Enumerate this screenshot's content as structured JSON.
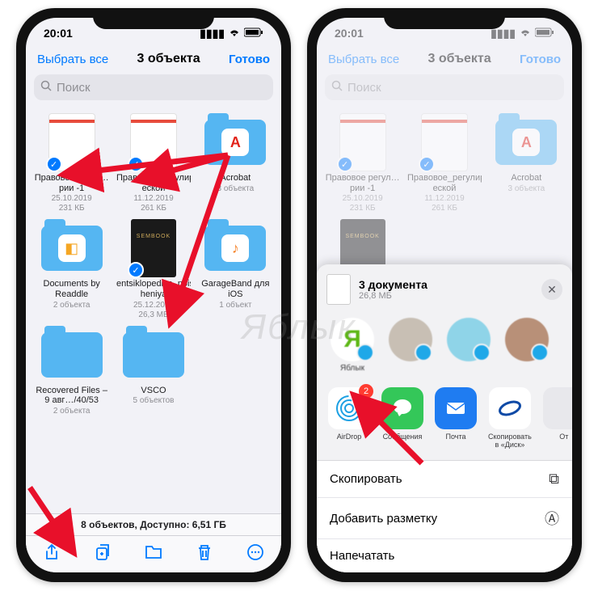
{
  "status": {
    "time": "20:01"
  },
  "left": {
    "nav": {
      "select_all": "Выбрать все",
      "title": "3 объекта",
      "done": "Готово"
    },
    "search": {
      "placeholder": "Поиск"
    },
    "items": [
      {
        "name": "Правовое регул…рии -1",
        "date": "25.10.2019",
        "size": "231 КБ",
        "type": "doc",
        "checked": true
      },
      {
        "name": "Правовое_регулиро…еской",
        "date": "11.12.2019",
        "size": "261 КБ",
        "type": "doc",
        "checked": true
      },
      {
        "name": "Acrobat",
        "sub": "3 объекта",
        "type": "folder",
        "icon_bg": "#fff",
        "icon_color": "#e2231a",
        "icon": "A"
      },
      {
        "name": "Documents by Readdle",
        "sub": "2 объекта",
        "type": "folder",
        "icon_bg": "#fff",
        "icon_color": "#f5a623",
        "icon": "◧"
      },
      {
        "name": "entsiklopediya_poisko…heniya",
        "date": "25.12.2019",
        "size": "26,3 МБ",
        "type": "sembook",
        "checked": true
      },
      {
        "name": "GarageBand для iOS",
        "sub": "1 объект",
        "type": "folder",
        "icon_bg": "#fff",
        "icon_color": "#f5842b",
        "icon": "♪"
      },
      {
        "name": "Recovered Files – 9 авг…/40/53",
        "sub": "2 объекта",
        "type": "folder"
      },
      {
        "name": "VSCO",
        "sub": "5 объектов",
        "type": "folder"
      }
    ],
    "footer": "8 объектов, Доступно: 6,51 ГБ"
  },
  "right": {
    "nav": {
      "select_all": "Выбрать все",
      "title": "3 объекта",
      "done": "Готово"
    },
    "sheet": {
      "title": "3 документа",
      "size": "26,8 МБ",
      "contacts": [
        {
          "name": "Яблык",
          "bg": "#fff",
          "fg": "#5db715",
          "letter": "Я"
        }
      ],
      "apps": [
        {
          "name": "AirDrop",
          "bg": "#ffffff",
          "fg": "#1ca0e3",
          "badge": "2"
        },
        {
          "name": "Сообщения",
          "bg": "#34c759"
        },
        {
          "name": "Почта",
          "bg": "#1f7cf1"
        },
        {
          "name": "Скопировать в «Диск»",
          "bg": "#ffffff",
          "fg": "#0f4aa6"
        },
        {
          "name": "От"
        }
      ],
      "actions": [
        {
          "label": "Скопировать",
          "icon": "⧉"
        },
        {
          "label": "Добавить разметку",
          "icon": "Ⓐ"
        },
        {
          "label": "Напечатать",
          "icon": ""
        }
      ]
    }
  },
  "watermark": "Яблык"
}
